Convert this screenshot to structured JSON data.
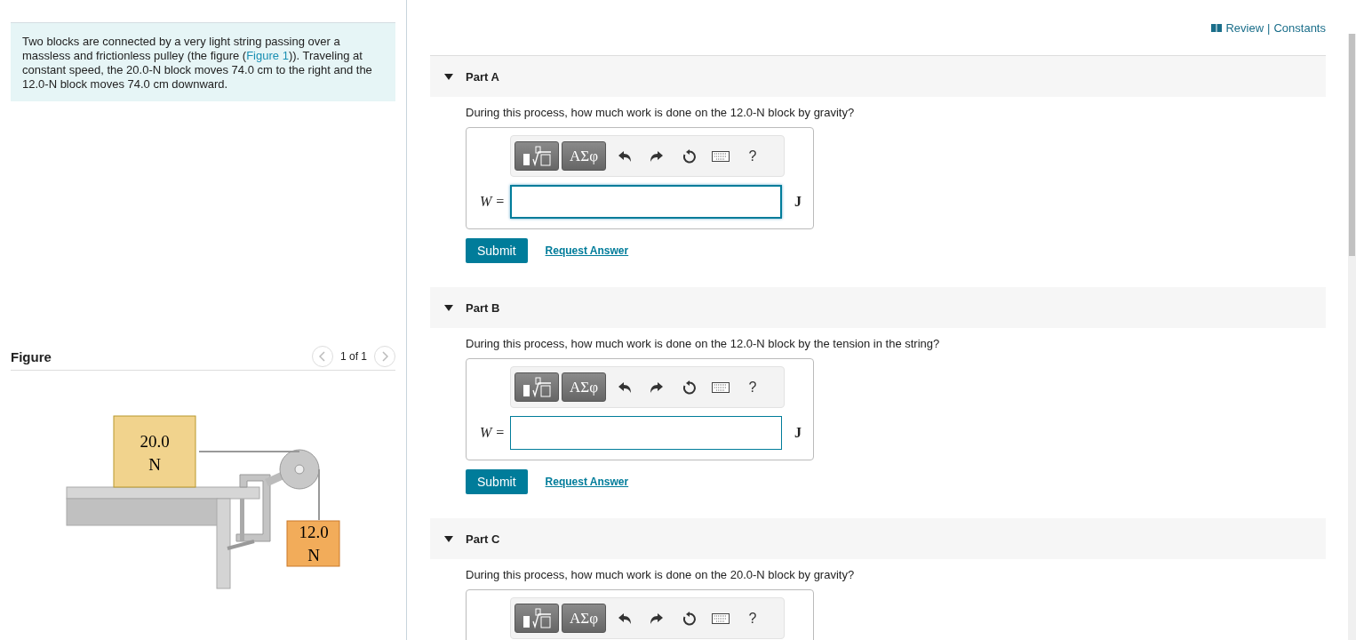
{
  "intro": {
    "before": "Two blocks are connected by a very light string passing over a massless and frictionless pulley (the figure (",
    "link": "Figure 1",
    "after": ")). Traveling at constant speed, the 20.0-N block moves 74.0 cm to the right and the 12.0-N block moves 74.0 cm downward."
  },
  "figure": {
    "title": "Figure",
    "pager": "1 of 1",
    "blocks": [
      {
        "weight": "20.0",
        "unit": "N"
      },
      {
        "weight": "12.0",
        "unit": "N"
      }
    ]
  },
  "header_links": [
    "Review",
    "|",
    "Constants"
  ],
  "parts": [
    {
      "title": "Part A",
      "expanded": true,
      "question": "During this process, how much work is done on the 12.0-N block by gravity?",
      "tools": [
        "ΑΣφ",
        "?"
      ],
      "label": "W =",
      "focused": true,
      "unit": "J",
      "submit": "Submit",
      "request": "Request Answer"
    },
    {
      "title": "Part B",
      "expanded": true,
      "question": "During this process, how much work is done on the 12.0-N block by the tension in the string?",
      "tools": [
        "ΑΣφ",
        "?"
      ],
      "label": "W =",
      "focused": false,
      "unit": "J",
      "submit": "Submit",
      "request": "Request Answer"
    },
    {
      "title": "Part C",
      "expanded": true,
      "question": "During this process, how much work is done on the 20.0-N block by gravity?",
      "tools": [
        "ΑΣφ",
        "?"
      ]
    }
  ]
}
